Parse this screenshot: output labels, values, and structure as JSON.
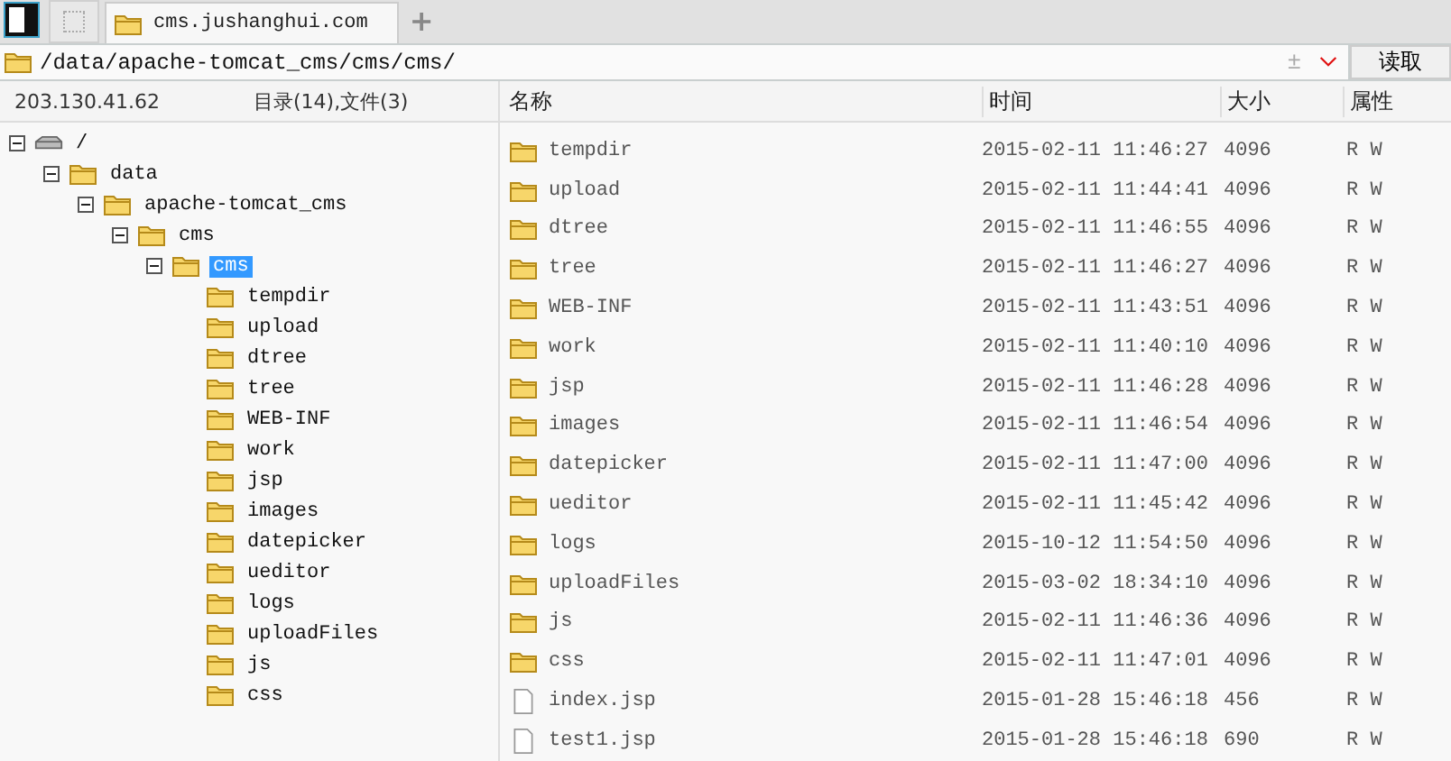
{
  "tab_bar": {
    "tabs": [
      {
        "label": "cms.jushanghui.com",
        "selected": true
      }
    ],
    "new_tab": "+"
  },
  "address_bar": {
    "path": "/data/apache-tomcat_cms/cms/cms/",
    "toggle": "±",
    "button": "读取"
  },
  "left_panel": {
    "host": "203.130.41.62",
    "summary": "目录(14),文件(3)",
    "tree": [
      {
        "label": "/",
        "kind": "drive",
        "expanded": true,
        "selected": false,
        "children": [
          {
            "label": "data",
            "kind": "folder",
            "expanded": true,
            "selected": false,
            "children": [
              {
                "label": "apache-tomcat_cms",
                "kind": "folder",
                "expanded": true,
                "selected": false,
                "children": [
                  {
                    "label": "cms",
                    "kind": "folder",
                    "expanded": true,
                    "selected": false,
                    "children": [
                      {
                        "label": "cms",
                        "kind": "folder",
                        "expanded": true,
                        "selected": true,
                        "children": [
                          {
                            "label": "tempdir",
                            "kind": "folder",
                            "selected": false
                          },
                          {
                            "label": "upload",
                            "kind": "folder",
                            "selected": false
                          },
                          {
                            "label": "dtree",
                            "kind": "folder",
                            "selected": false
                          },
                          {
                            "label": "tree",
                            "kind": "folder",
                            "selected": false
                          },
                          {
                            "label": "WEB-INF",
                            "kind": "folder",
                            "selected": false
                          },
                          {
                            "label": "work",
                            "kind": "folder",
                            "selected": false
                          },
                          {
                            "label": "jsp",
                            "kind": "folder",
                            "selected": false
                          },
                          {
                            "label": "images",
                            "kind": "folder",
                            "selected": false
                          },
                          {
                            "label": "datepicker",
                            "kind": "folder",
                            "selected": false
                          },
                          {
                            "label": "ueditor",
                            "kind": "folder",
                            "selected": false
                          },
                          {
                            "label": "logs",
                            "kind": "folder",
                            "selected": false
                          },
                          {
                            "label": "uploadFiles",
                            "kind": "folder",
                            "selected": false
                          },
                          {
                            "label": "js",
                            "kind": "folder",
                            "selected": false
                          },
                          {
                            "label": "css",
                            "kind": "folder",
                            "selected": false
                          }
                        ]
                      }
                    ]
                  }
                ]
              }
            ]
          }
        ]
      }
    ]
  },
  "file_list": {
    "columns": [
      "名称",
      "时间",
      "大小",
      "属性"
    ],
    "rows": [
      {
        "kind": "folder",
        "name": "tempdir",
        "time": "2015-02-11 11:46:27",
        "size": "4096",
        "attr": "R W"
      },
      {
        "kind": "folder",
        "name": "upload",
        "time": "2015-02-11 11:44:41",
        "size": "4096",
        "attr": "R W"
      },
      {
        "kind": "folder",
        "name": "dtree",
        "time": "2015-02-11 11:46:55",
        "size": "4096",
        "attr": "R W"
      },
      {
        "kind": "folder",
        "name": "tree",
        "time": "2015-02-11 11:46:27",
        "size": "4096",
        "attr": "R W"
      },
      {
        "kind": "folder",
        "name": "WEB-INF",
        "time": "2015-02-11 11:43:51",
        "size": "4096",
        "attr": "R W"
      },
      {
        "kind": "folder",
        "name": "work",
        "time": "2015-02-11 11:40:10",
        "size": "4096",
        "attr": "R W"
      },
      {
        "kind": "folder",
        "name": "jsp",
        "time": "2015-02-11 11:46:28",
        "size": "4096",
        "attr": "R W"
      },
      {
        "kind": "folder",
        "name": "images",
        "time": "2015-02-11 11:46:54",
        "size": "4096",
        "attr": "R W"
      },
      {
        "kind": "folder",
        "name": "datepicker",
        "time": "2015-02-11 11:47:00",
        "size": "4096",
        "attr": "R W"
      },
      {
        "kind": "folder",
        "name": "ueditor",
        "time": "2015-02-11 11:45:42",
        "size": "4096",
        "attr": "R W"
      },
      {
        "kind": "folder",
        "name": "logs",
        "time": "2015-10-12 11:54:50",
        "size": "4096",
        "attr": "R W"
      },
      {
        "kind": "folder",
        "name": "uploadFiles",
        "time": "2015-03-02 18:34:10",
        "size": "4096",
        "attr": "R W"
      },
      {
        "kind": "folder",
        "name": "js",
        "time": "2015-02-11 11:46:36",
        "size": "4096",
        "attr": "R W"
      },
      {
        "kind": "folder",
        "name": "css",
        "time": "2015-02-11 11:47:01",
        "size": "4096",
        "attr": "R W"
      },
      {
        "kind": "file",
        "name": "index.jsp",
        "time": "2015-01-28 15:46:18",
        "size": "456",
        "attr": "R W"
      },
      {
        "kind": "file",
        "name": "test1.jsp",
        "time": "2015-01-28 15:46:18",
        "size": "690",
        "attr": "R W"
      }
    ]
  }
}
